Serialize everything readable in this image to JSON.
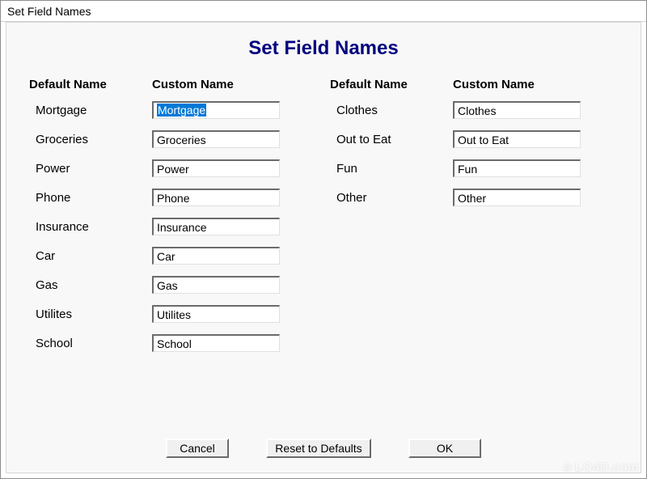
{
  "window": {
    "title": "Set Field Names"
  },
  "dialog": {
    "heading": "Set Field Names",
    "headers": {
      "default": "Default Name",
      "custom": "Custom Name"
    }
  },
  "left_fields": [
    {
      "default": "Mortgage",
      "custom": "Mortgage",
      "selected": true
    },
    {
      "default": "Groceries",
      "custom": "Groceries",
      "selected": false
    },
    {
      "default": "Power",
      "custom": "Power",
      "selected": false
    },
    {
      "default": "Phone",
      "custom": "Phone",
      "selected": false
    },
    {
      "default": "Insurance",
      "custom": "Insurance",
      "selected": false
    },
    {
      "default": "Car",
      "custom": "Car",
      "selected": false
    },
    {
      "default": "Gas",
      "custom": "Gas",
      "selected": false
    },
    {
      "default": "Utilites",
      "custom": "Utilites",
      "selected": false
    },
    {
      "default": "School",
      "custom": "School",
      "selected": false
    }
  ],
  "right_fields": [
    {
      "default": "Clothes",
      "custom": "Clothes",
      "selected": false
    },
    {
      "default": "Out to Eat",
      "custom": "Out to Eat",
      "selected": false
    },
    {
      "default": "Fun",
      "custom": "Fun",
      "selected": false
    },
    {
      "default": "Other",
      "custom": "Other",
      "selected": false
    }
  ],
  "buttons": {
    "cancel": "Cancel",
    "reset": "Reset to Defaults",
    "ok": "OK"
  },
  "watermark": "LO4D.com"
}
